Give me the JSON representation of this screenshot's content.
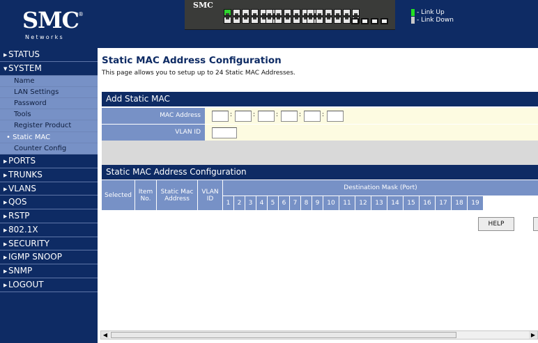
{
  "header": {
    "logo_text": "SMC",
    "logo_sub": "Networks",
    "logo_mark": "®",
    "switch_brand": "SMC",
    "legend": [
      {
        "label": "- Link Up",
        "color": "#22e022"
      },
      {
        "label": "- Link Down",
        "color": "#c8c8c8"
      }
    ]
  },
  "sidebar": {
    "items": [
      {
        "label": "STATUS",
        "arrow": "▶"
      },
      {
        "label": "SYSTEM",
        "arrow": "▼"
      }
    ],
    "system_sub": [
      {
        "label": "Name"
      },
      {
        "label": "LAN Settings"
      },
      {
        "label": "Password"
      },
      {
        "label": "Tools"
      },
      {
        "label": "Register Product"
      },
      {
        "label": "Static MAC",
        "bullet": "•"
      },
      {
        "label": "Counter Config"
      }
    ],
    "more_items": [
      {
        "label": "PORTS",
        "arrow": "▶"
      },
      {
        "label": "TRUNKS",
        "arrow": "▶"
      },
      {
        "label": "VLANS",
        "arrow": "▶"
      },
      {
        "label": "QOS",
        "arrow": "▶"
      },
      {
        "label": "RSTP",
        "arrow": "▶"
      },
      {
        "label": "802.1X",
        "arrow": "▶"
      },
      {
        "label": "SECURITY",
        "arrow": "▶"
      },
      {
        "label": "IGMP SNOOP",
        "arrow": "▶"
      },
      {
        "label": "SNMP",
        "arrow": "▶"
      },
      {
        "label": "LOGOUT",
        "arrow": "▶"
      }
    ]
  },
  "main": {
    "title": "Static MAC Address Configuration",
    "description": "This page allows you to setup up to 24 Static MAC Addresses.",
    "add_section": {
      "title": "Add Static MAC",
      "mac_label": "MAC Address",
      "mac_separator": ":",
      "vlan_label": "VLAN ID",
      "mac_values": [
        "",
        "",
        "",
        "",
        "",
        ""
      ],
      "vlan_value": ""
    },
    "table_section": {
      "title": "Static MAC Address Configuration",
      "col_selected": "Selected",
      "col_item": "Item No.",
      "col_mac": "Static Mac Address",
      "col_vlan": "VLAN ID",
      "col_dest": "Destination Mask (Port)",
      "ports": [
        "1",
        "2",
        "3",
        "4",
        "5",
        "6",
        "7",
        "8",
        "9",
        "10",
        "11",
        "12",
        "13",
        "14",
        "15",
        "16",
        "17",
        "18",
        "19"
      ]
    },
    "buttons": {
      "help": "HELP"
    }
  },
  "colors": {
    "navy": "#0e2b64",
    "table_header": "#7791c6",
    "form_bg": "#fdfbe1"
  }
}
